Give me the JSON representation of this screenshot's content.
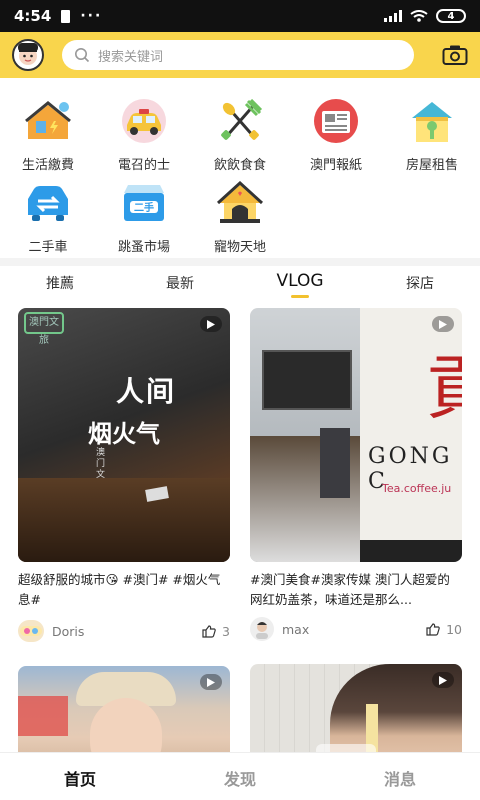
{
  "status": {
    "time": "4:54",
    "dots": "···",
    "battery": "4"
  },
  "search": {
    "placeholder": "搜索关键词"
  },
  "categories": [
    {
      "label": "生活繳費",
      "icon": "house-bill-icon"
    },
    {
      "label": "電召的士",
      "icon": "taxi-icon"
    },
    {
      "label": "飲飲食食",
      "icon": "cutlery-icon"
    },
    {
      "label": "澳門報紙",
      "icon": "newspaper-icon"
    },
    {
      "label": "房屋租售",
      "icon": "house-key-icon"
    },
    {
      "label": "二手車",
      "icon": "car-swap-icon"
    },
    {
      "label": "跳蚤市場",
      "icon": "secondhand-box-icon"
    },
    {
      "label": "寵物天地",
      "icon": "pet-house-icon"
    }
  ],
  "tabs": [
    {
      "label": "推薦"
    },
    {
      "label": "最新"
    },
    {
      "label": "VLOG"
    },
    {
      "label": "探店"
    }
  ],
  "feed": [
    {
      "caption": "超级舒服的城市😘 #澳门# #烟火气息#",
      "thumb_text": {
        "logo": "澳門文旅",
        "line1": "人间",
        "line2": "烟火气",
        "small": "澳门文旅"
      },
      "user": "Doris",
      "likes": "3"
    },
    {
      "caption": "#澳门美食#澳家传媒 澳门人超爱的网红奶盖茶，味道还是那么...",
      "thumb_text": {
        "sign": "GONG C",
        "sub": "Tea.coffee.ju"
      },
      "user": "max",
      "likes": "10"
    },
    {
      "caption": "",
      "user": "",
      "likes": ""
    },
    {
      "caption": "",
      "user": "",
      "likes": ""
    }
  ],
  "nav": [
    {
      "label": "首页"
    },
    {
      "label": "发现"
    },
    {
      "label": "消息"
    }
  ],
  "colors": {
    "accent": "#f9d54c",
    "underline": "#f2c12e"
  }
}
